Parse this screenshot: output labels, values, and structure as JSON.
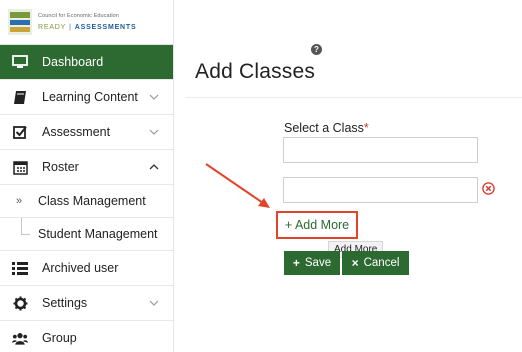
{
  "brand": {
    "org_name": "Council for Economic Education",
    "product_ready": "READY",
    "product_separator": "|",
    "product_assessments": "ASSESSMENTS"
  },
  "sidebar": {
    "items": [
      {
        "label": "Dashboard",
        "icon": "monitor-icon",
        "active": true
      },
      {
        "label": "Learning Content",
        "icon": "book-icon",
        "chevron": "down"
      },
      {
        "label": "Assessment",
        "icon": "checkbox-icon",
        "chevron": "down"
      },
      {
        "label": "Roster",
        "icon": "calendar-icon",
        "chevron": "up"
      },
      {
        "label": "Class Management",
        "marker": "»"
      },
      {
        "label": "Student Management"
      },
      {
        "label": "Archived user",
        "icon": "list-icon"
      },
      {
        "label": "Settings",
        "icon": "gear-icon",
        "chevron": "down"
      },
      {
        "label": "Group",
        "icon": "users-icon"
      }
    ]
  },
  "main": {
    "help_badge": "?",
    "title": "Add Classes",
    "select_label": "Select a Class",
    "required_mark": "*",
    "add_more_label": "+ Add More",
    "tooltip": "Add More",
    "save_label": "Save",
    "save_glyph": "+",
    "cancel_label": "Cancel",
    "cancel_glyph": "×"
  },
  "colors": {
    "primary_green": "#2d6a32",
    "highlight_red": "#e0452a",
    "required_red": "#c0392b"
  }
}
